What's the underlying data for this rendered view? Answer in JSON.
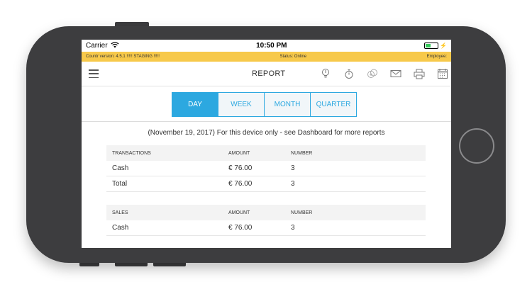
{
  "status_bar": {
    "carrier": "Carrier",
    "time": "10:50 PM"
  },
  "info_bar": {
    "version": "Countr version:  4.5.1 !!!!! STAGING !!!!!",
    "status": "Status:  Online",
    "employee": "Employee:"
  },
  "app_bar": {
    "title": "REPORT"
  },
  "tabs": [
    {
      "label": "DAY",
      "active": true
    },
    {
      "label": "WEEK",
      "active": false
    },
    {
      "label": "MONTH",
      "active": false
    },
    {
      "label": "QUARTER",
      "active": false
    }
  ],
  "report_note": "(November 19, 2017) For this device only - see Dashboard for more reports",
  "transactions_table": {
    "headers": [
      "TRANSACTIONS",
      "AMOUNT",
      "NUMBER"
    ],
    "rows": [
      [
        "Cash",
        "€ 76.00",
        "3"
      ],
      [
        "Total",
        "€ 76.00",
        "3"
      ]
    ]
  },
  "sales_table": {
    "headers": [
      "SALES",
      "AMOUNT",
      "NUMBER"
    ],
    "rows": [
      [
        "Cash",
        "€ 76.00",
        "3"
      ]
    ]
  },
  "colors": {
    "accent": "#2ca8e0",
    "info_bar": "#f7c94b",
    "phone_body": "#3d3d3f"
  },
  "icons": [
    "hamburger-icon",
    "bulb-icon",
    "stopwatch-icon",
    "coins-icon",
    "mail-icon",
    "printer-icon",
    "calendar-icon",
    "wifi-icon",
    "battery-icon"
  ]
}
